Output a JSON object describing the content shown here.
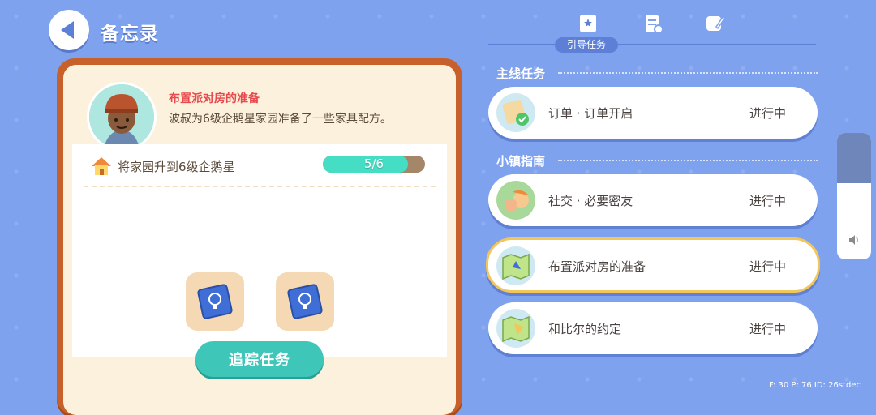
{
  "header": {
    "title": "备忘录"
  },
  "task": {
    "title": "布置派对房的准备",
    "description": "波叔为6级企鹅星家园准备了一些家具配方。",
    "requirement": "将家园升到6级企鹅星",
    "progress_text": "5/6",
    "progress_fraction": 0.833,
    "track_button": "追踪任务"
  },
  "tabs": {
    "active_label": "引导任务"
  },
  "sections": [
    {
      "label": "主线任务",
      "quests": [
        {
          "name": "订单 · 订单开启",
          "status": "进行中"
        }
      ]
    },
    {
      "label": "小镇指南",
      "quests": [
        {
          "name": "社交 · 必要密友",
          "status": "进行中"
        },
        {
          "name": "布置派对房的准备",
          "status": "进行中"
        },
        {
          "name": "和比尔的约定",
          "status": "进行中"
        }
      ]
    }
  ],
  "volume": {
    "level_fraction": 0.4
  },
  "debug": "F: 30  P: 76  ID: 26stdec"
}
